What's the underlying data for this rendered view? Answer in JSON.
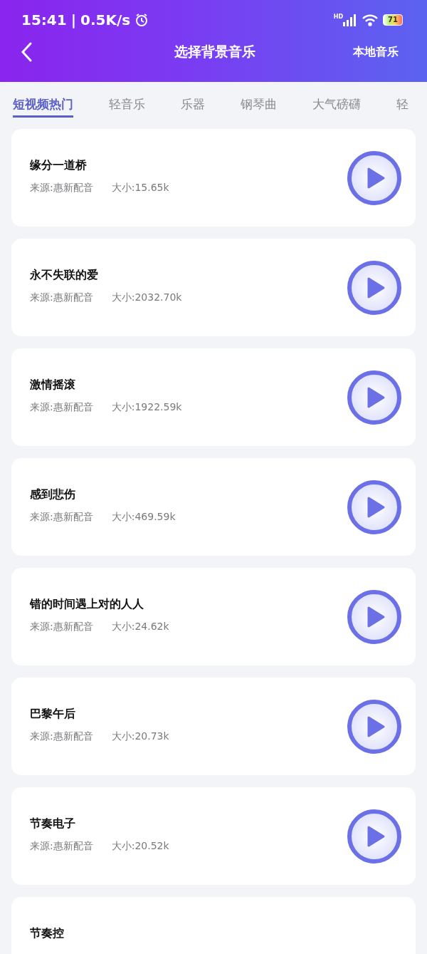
{
  "status_bar": {
    "time": "15:41",
    "separator": "|",
    "speed": "0.5K/s",
    "network": "HD",
    "battery": "71"
  },
  "nav": {
    "title": "选择背景音乐",
    "action": "本地音乐"
  },
  "tabs": [
    {
      "label": "短视频热门",
      "selected": true
    },
    {
      "label": "轻音乐",
      "selected": false
    },
    {
      "label": "乐器",
      "selected": false
    },
    {
      "label": "钢琴曲",
      "selected": false
    },
    {
      "label": "大气磅礴",
      "selected": false
    },
    {
      "label": "轻",
      "selected": false
    }
  ],
  "tracks": [
    {
      "title": "缘分一道桥",
      "source": "来源:惠新配音",
      "size": "大小:15.65k"
    },
    {
      "title": "永不失联的爱",
      "source": "来源:惠新配音",
      "size": "大小:2032.70k"
    },
    {
      "title": "激情摇滚",
      "source": "来源:惠新配音",
      "size": "大小:1922.59k"
    },
    {
      "title": "感到悲伤",
      "source": "来源:惠新配音",
      "size": "大小:469.59k"
    },
    {
      "title": "错的时间遇上对的人人",
      "source": "来源:惠新配音",
      "size": "大小:24.62k"
    },
    {
      "title": "巴黎午后",
      "source": "来源:惠新配音",
      "size": "大小:20.73k"
    },
    {
      "title": "节奏电子",
      "source": "来源:惠新配音",
      "size": "大小:20.52k"
    },
    {
      "title": "节奏控",
      "cut": true
    }
  ]
}
